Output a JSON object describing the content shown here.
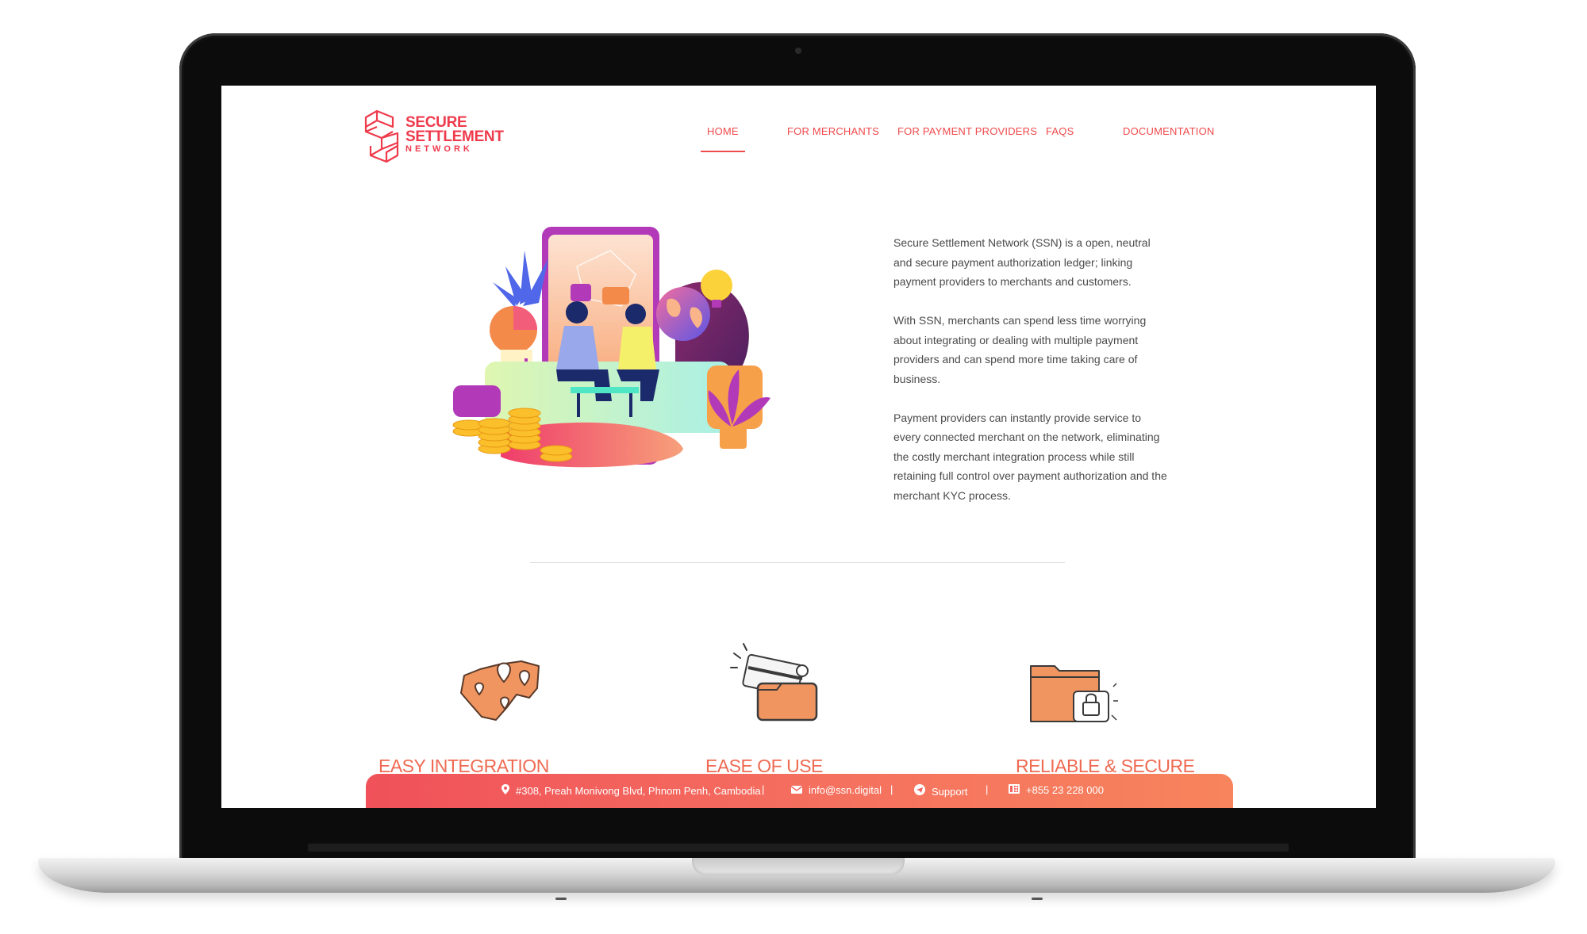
{
  "nav": {
    "items": [
      {
        "label": "HOME",
        "active": true
      },
      {
        "label": "FOR MERCHANTS",
        "active": false
      },
      {
        "label": "FOR PAYMENT PROVIDERS",
        "active": false
      },
      {
        "label": "FAQS",
        "active": false
      },
      {
        "label": "DOCUMENTATION",
        "active": false
      }
    ]
  },
  "logo": {
    "line1": "SECURE",
    "line2": "SETTLEMENT",
    "line3": "NETWORK"
  },
  "intro": {
    "p1": "Secure Settlement Network (SSN) is a open, neutral and secure payment authorization ledger; linking payment providers to merchants and customers.",
    "p2": "With SSN, merchants can spend less time worrying about integrating or dealing with multiple payment providers and can spend more time taking care of business.",
    "p3": "Payment providers can instantly provide service to every connected merchant on the network, eliminating the costly merchant integration process while still retaining full control over payment authorization and the merchant KYC process."
  },
  "features": [
    {
      "title": "EASY INTEGRATION",
      "icon": "cambodia-map-pins-icon"
    },
    {
      "title": "EASE OF USE",
      "icon": "card-wallet-icon"
    },
    {
      "title": "RELIABLE & SECURE",
      "icon": "secure-folder-icon"
    }
  ],
  "footer": {
    "address": "#308, Preah Monivong Blvd, Phnom Penh, Cambodia",
    "email": "info@ssn.digital",
    "support": "Support",
    "phone": "+855 23 228 000",
    "separator": "|"
  },
  "colors": {
    "accent": "#ef4a4c",
    "feature": "#ef6a52",
    "footer_start": "#f0515a",
    "footer_end": "#f7845c"
  }
}
